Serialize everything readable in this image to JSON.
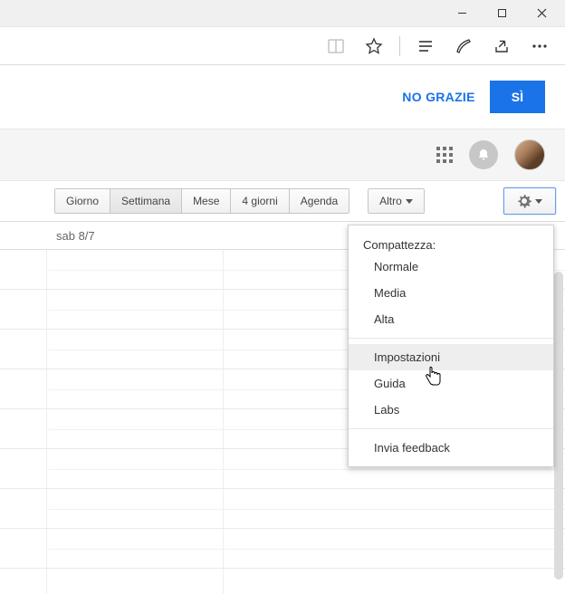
{
  "window_controls": {
    "minimize": "minimize-icon",
    "maximize": "maximize-icon",
    "close": "close-icon"
  },
  "browser_icons": [
    "book-icon",
    "star-icon",
    "reading-list-icon",
    "pen-icon",
    "share-icon",
    "more-icon"
  ],
  "promo": {
    "no_label": "NO GRAZIE",
    "yes_label": "SÌ"
  },
  "header_icons": {
    "apps": "apps-icon",
    "notifications": "bell-icon",
    "avatar": "avatar"
  },
  "views": {
    "items": [
      "Giorno",
      "Settimana",
      "Mese",
      "4 giorni",
      "Agenda"
    ],
    "active_index": 1,
    "more_label": "Altro",
    "gear": "gear-icon"
  },
  "day_header": "sab 8/7",
  "settings_menu": {
    "title": "Compattezza:",
    "density": [
      "Normale",
      "Media",
      "Alta"
    ],
    "items": [
      "Impostazioni",
      "Guida",
      "Labs"
    ],
    "hover_index": 0,
    "feedback": "Invia feedback"
  }
}
